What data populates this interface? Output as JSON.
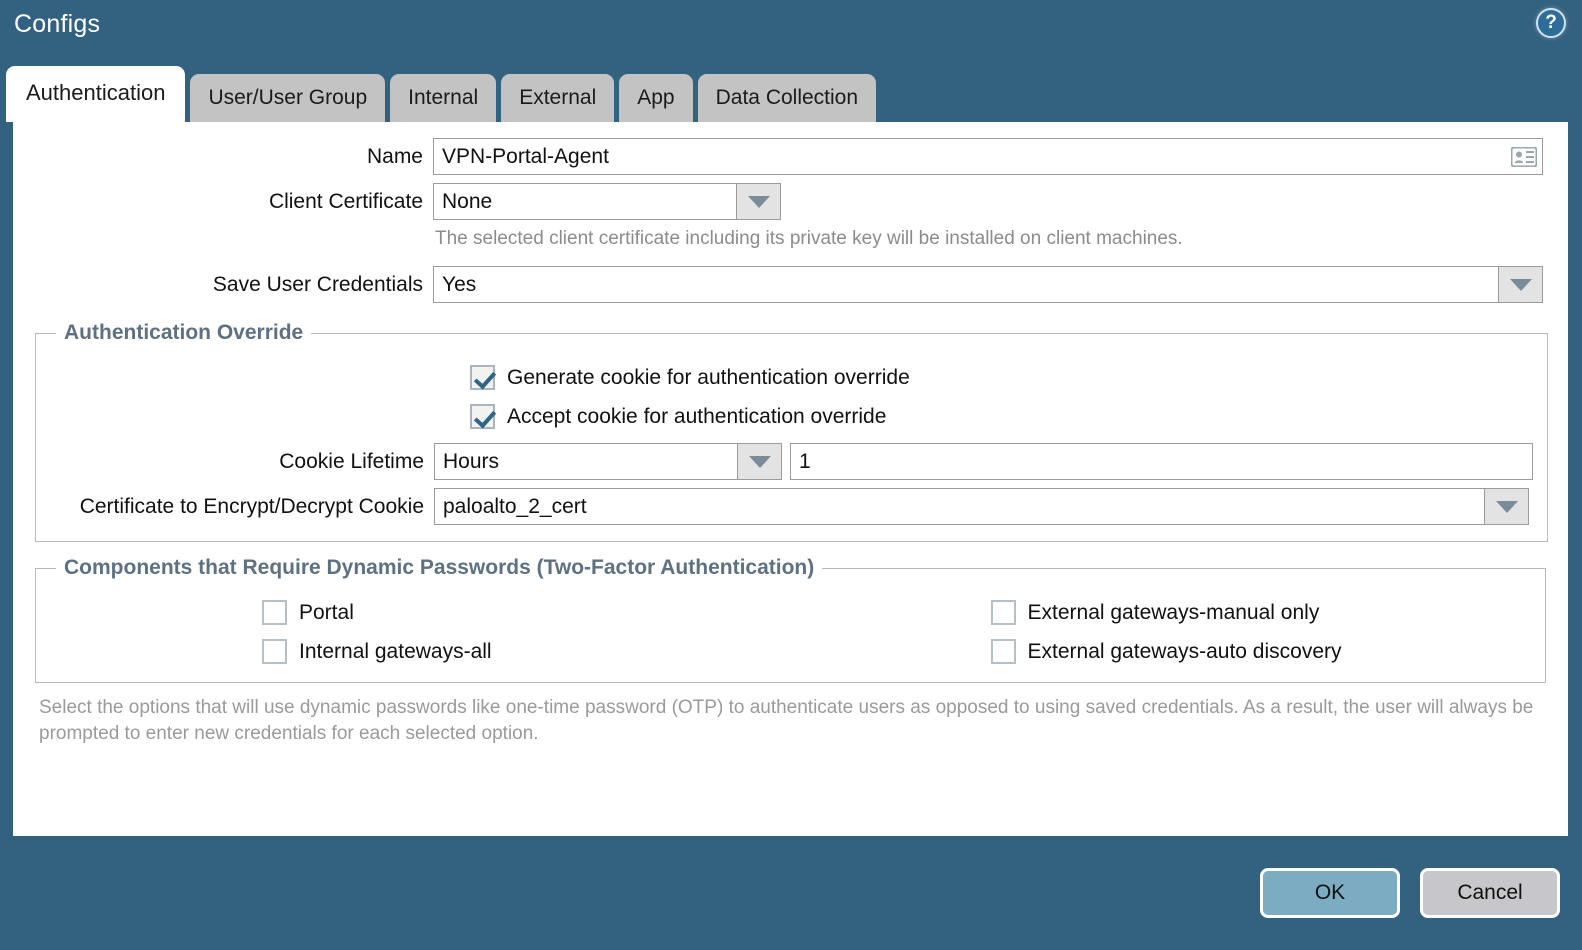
{
  "window": {
    "title": "Configs",
    "help_icon": "help-circle-icon",
    "help_glyph": "?"
  },
  "tabs": [
    {
      "label": "Authentication",
      "active": true
    },
    {
      "label": "User/User Group",
      "active": false
    },
    {
      "label": "Internal",
      "active": false
    },
    {
      "label": "External",
      "active": false
    },
    {
      "label": "App",
      "active": false
    },
    {
      "label": "Data Collection",
      "active": false
    }
  ],
  "form": {
    "name": {
      "label": "Name",
      "value": "VPN-Portal-Agent",
      "icon": "id-card-icon"
    },
    "client_certificate": {
      "label": "Client Certificate",
      "value": "None",
      "hint": "The selected client certificate including its private key will be installed on client machines."
    },
    "save_user_credentials": {
      "label": "Save User Credentials",
      "value": "Yes"
    }
  },
  "auth_override": {
    "legend": "Authentication Override",
    "generate_cookie": {
      "label": "Generate cookie for authentication override",
      "checked": true
    },
    "accept_cookie": {
      "label": "Accept cookie for authentication override",
      "checked": true
    },
    "cookie_lifetime": {
      "label": "Cookie Lifetime",
      "unit": "Hours",
      "amount": "1"
    },
    "cookie_cert": {
      "label": "Certificate to Encrypt/Decrypt Cookie",
      "value": "paloalto_2_cert"
    }
  },
  "dynamic_passwords": {
    "legend": "Components that Require Dynamic Passwords (Two-Factor Authentication)",
    "options": [
      {
        "label": "Portal",
        "checked": false
      },
      {
        "label": "Internal gateways-all",
        "checked": false
      },
      {
        "label": "External gateways-manual only",
        "checked": false
      },
      {
        "label": "External gateways-auto discovery",
        "checked": false
      }
    ],
    "note": "Select the options that will use dynamic passwords like one-time password (OTP) to authenticate users as opposed to using saved credentials. As a result, the user will always be prompted to enter new credentials for each selected option."
  },
  "footer": {
    "ok_label": "OK",
    "cancel_label": "Cancel"
  },
  "colors": {
    "chrome": "#336281",
    "tab_inactive": "#c3c3c3",
    "legend": "#5d7183",
    "ok_button": "#7cacc2",
    "cancel_button": "#c7c7cb",
    "checkmark": "#2f6585"
  }
}
